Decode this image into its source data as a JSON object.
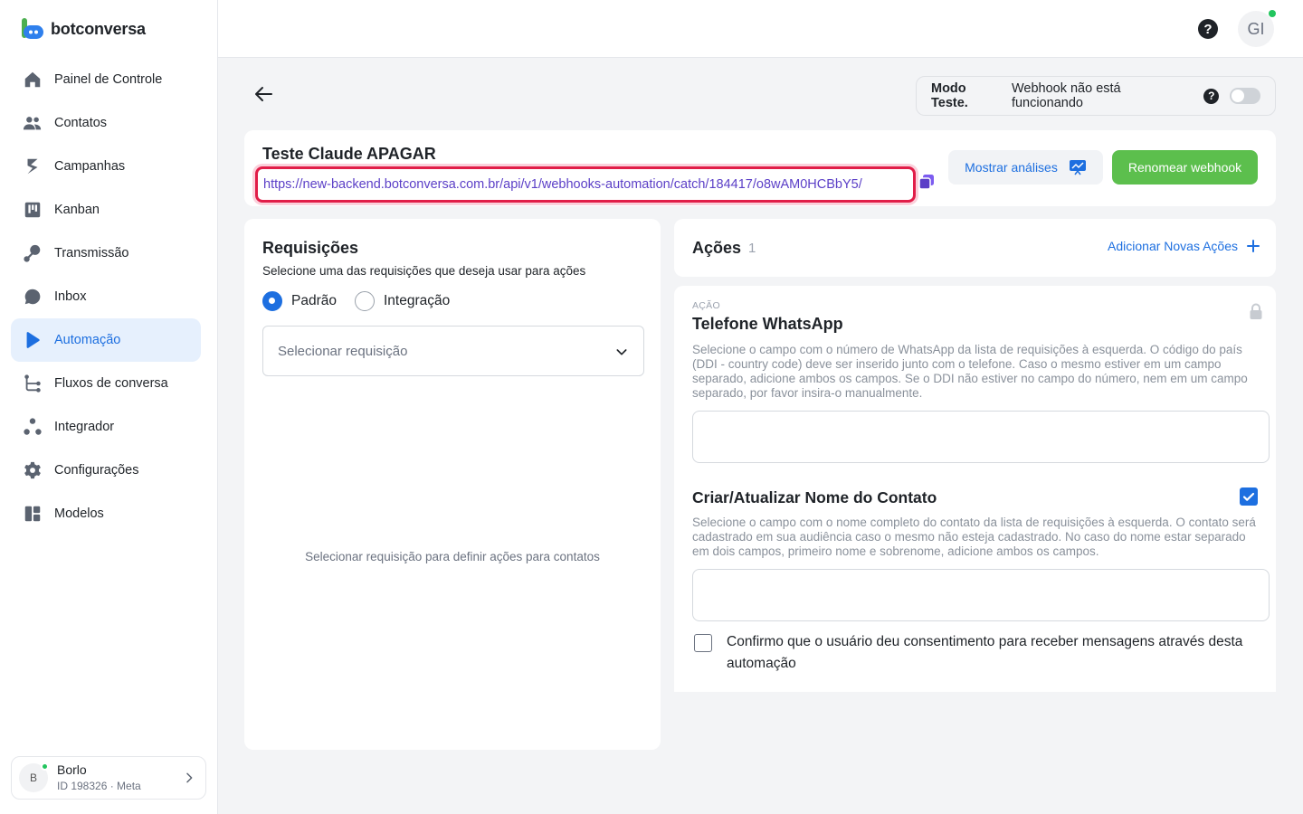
{
  "brand": {
    "name": "botconversa"
  },
  "sidebar": {
    "items": [
      {
        "label": "Painel de Controle",
        "icon": "home-icon"
      },
      {
        "label": "Contatos",
        "icon": "users-icon"
      },
      {
        "label": "Campanhas",
        "icon": "campaign-icon"
      },
      {
        "label": "Kanban",
        "icon": "kanban-icon"
      },
      {
        "label": "Transmissão",
        "icon": "broadcast-icon"
      },
      {
        "label": "Inbox",
        "icon": "chat-bubble-icon"
      },
      {
        "label": "Automação",
        "icon": "play-icon",
        "active": true
      },
      {
        "label": "Fluxos de conversa",
        "icon": "flow-icon"
      },
      {
        "label": "Integrador",
        "icon": "integrator-icon"
      },
      {
        "label": "Configurações",
        "icon": "gear-icon"
      },
      {
        "label": "Modelos",
        "icon": "templates-icon"
      }
    ],
    "account": {
      "initial": "B",
      "name": "Borlo",
      "id_text": "ID 198326 · Meta"
    }
  },
  "topbar": {
    "user_initials": "GI",
    "help_symbol": "?"
  },
  "mode": {
    "bold": "Modo Teste.",
    "text": "Webhook não está funcionando",
    "toggle_on": false
  },
  "webhook": {
    "title": "Teste Claude APAGAR",
    "url": "https://new-backend.botconversa.com.br/api/v1/webhooks-automation/catch/184417/o8wAM0HCBbY5/",
    "analyses_label": "Mostrar análises",
    "rename_label": "Renomear webhook"
  },
  "requests": {
    "title": "Requisições",
    "subtitle": "Selecione uma das requisições que deseja usar para ações",
    "options": [
      {
        "label": "Padrão",
        "selected": true
      },
      {
        "label": "Integração",
        "selected": false
      }
    ],
    "select_placeholder": "Selecionar requisição",
    "empty_text": "Selecionar requisição para definir ações para contatos"
  },
  "actions": {
    "title": "Ações",
    "count": "1",
    "add_label": "Adicionar Novas Ações",
    "card": {
      "label": "AÇÃO",
      "name": "Telefone WhatsApp",
      "description": "Selecione o campo com o número de WhatsApp da lista de requisições à esquerda. O código do país (DDI - country code) deve ser inserido junto com o telefone. Caso o mesmo estiver em um campo separado, adicione ambos os campos. Se o DDI não estiver no campo do número, nem em um campo separado, por favor insira-o manualmente.",
      "option_title": "Criar/Atualizar Nome do Contato",
      "option_checked": true,
      "option_description": "Selecione o campo com o nome completo do contato da lista de requisições à esquerda. O contato será cadastrado em sua audiência caso o mesmo não esteja cadastrado. No caso do nome estar separado em dois campos, primeiro nome e sobrenome, adicione ambos os campos.",
      "consent_text": "Confirmo que o usuário deu consentimento para receber mensagens através desta automação",
      "consent_checked": false
    }
  },
  "colors": {
    "accent": "#1d6fe0",
    "green": "#5cbf4d",
    "url_highlight": "#e11d48"
  }
}
